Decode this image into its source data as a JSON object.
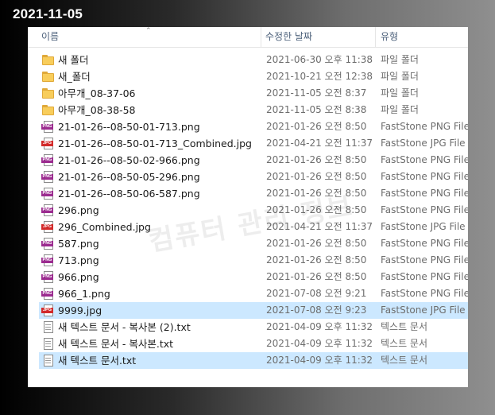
{
  "date_label": "2021-11-05",
  "watermark": "컴퓨터 관리 정보",
  "columns": {
    "name": "이름",
    "date": "수정한 날짜",
    "type": "유형"
  },
  "files": [
    {
      "icon": "folder-icon",
      "name": "새 폴더",
      "date": "2021-06-30 오후 11:38",
      "type": "파일 폴더"
    },
    {
      "icon": "folder-icon",
      "name": "새_폴더",
      "date": "2021-10-21 오전 12:38",
      "type": "파일 폴더"
    },
    {
      "icon": "folder-icon",
      "name": "아무개_08-37-06",
      "date": "2021-11-05 오전 8:37",
      "type": "파일 폴더"
    },
    {
      "icon": "folder-icon",
      "name": "아무개_08-38-58",
      "date": "2021-11-05 오전 8:38",
      "type": "파일 폴더"
    },
    {
      "icon": "png-icon",
      "name": "21-01-26--08-50-01-713.png",
      "date": "2021-01-26 오전 8:50",
      "type": "FastStone PNG File"
    },
    {
      "icon": "jpg-icon",
      "name": "21-01-26--08-50-01-713_Combined.jpg",
      "date": "2021-04-21 오전 11:37",
      "type": "FastStone JPG File"
    },
    {
      "icon": "png-icon",
      "name": "21-01-26--08-50-02-966.png",
      "date": "2021-01-26 오전 8:50",
      "type": "FastStone PNG File"
    },
    {
      "icon": "png-icon",
      "name": "21-01-26--08-50-05-296.png",
      "date": "2021-01-26 오전 8:50",
      "type": "FastStone PNG File"
    },
    {
      "icon": "png-icon",
      "name": "21-01-26--08-50-06-587.png",
      "date": "2021-01-26 오전 8:50",
      "type": "FastStone PNG File"
    },
    {
      "icon": "png-icon",
      "name": "296.png",
      "date": "2021-01-26 오전 8:50",
      "type": "FastStone PNG File"
    },
    {
      "icon": "jpg-icon",
      "name": "296_Combined.jpg",
      "date": "2021-04-21 오전 11:37",
      "type": "FastStone JPG File"
    },
    {
      "icon": "png-icon",
      "name": "587.png",
      "date": "2021-01-26 오전 8:50",
      "type": "FastStone PNG File"
    },
    {
      "icon": "png-icon",
      "name": "713.png",
      "date": "2021-01-26 오전 8:50",
      "type": "FastStone PNG File"
    },
    {
      "icon": "png-icon",
      "name": "966.png",
      "date": "2021-01-26 오전 8:50",
      "type": "FastStone PNG File"
    },
    {
      "icon": "png-icon",
      "name": "966_1.png",
      "date": "2021-07-08 오전 9:21",
      "type": "FastStone PNG File"
    },
    {
      "icon": "jpg-icon",
      "name": "9999.jpg",
      "date": "2021-07-08 오전 9:23",
      "type": "FastStone JPG File",
      "selected": true
    },
    {
      "icon": "txt-icon",
      "name": "새 텍스트 문서 - 복사본 (2).txt",
      "date": "2021-04-09 오후 11:32",
      "type": "텍스트 문서"
    },
    {
      "icon": "txt-icon",
      "name": "새 텍스트 문서 - 복사본.txt",
      "date": "2021-04-09 오후 11:32",
      "type": "텍스트 문서"
    },
    {
      "icon": "txt-icon",
      "name": "새 텍스트 문서.txt",
      "date": "2021-04-09 오후 11:32",
      "type": "텍스트 문서",
      "selected": true
    }
  ],
  "colors": {
    "selection": "#cce8ff",
    "header_text": "#4c607a",
    "folder": "#f8cd5b",
    "png_badge": "#9b2b8f",
    "jpg_badge": "#d22a2a"
  }
}
